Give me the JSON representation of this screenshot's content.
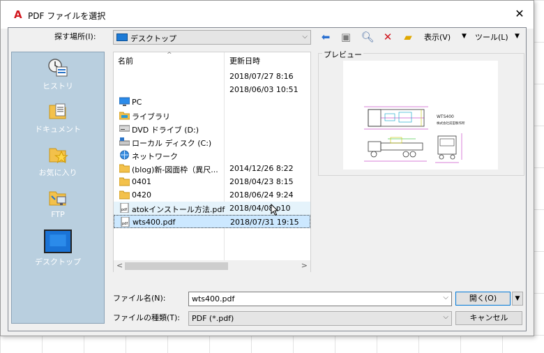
{
  "window": {
    "title": "PDF ファイルを選択",
    "app_icon": "autocad-a-icon"
  },
  "toolbar": {
    "look_in_label": "探す場所(I):",
    "look_in_value": "デスクトップ",
    "views_label": "表示(V)",
    "tools_label": "ツール(L)"
  },
  "places": [
    {
      "label": "ヒストリ",
      "icon": "history-icon"
    },
    {
      "label": "ドキュメント",
      "icon": "documents-icon"
    },
    {
      "label": "お気に入り",
      "icon": "favorites-icon"
    },
    {
      "label": "FTP",
      "icon": "ftp-icon"
    },
    {
      "label": "デスクトップ",
      "icon": "desktop-icon"
    }
  ],
  "file_list": {
    "columns": {
      "name": "名前",
      "modified": "更新日時"
    },
    "rows": [
      {
        "name": "",
        "date": "2018/07/27 8:16",
        "icon": ""
      },
      {
        "name": "",
        "date": "2018/06/03 10:51",
        "icon": ""
      },
      {
        "name": "PC",
        "date": "",
        "icon": "pc-icon"
      },
      {
        "name": "ライブラリ",
        "date": "",
        "icon": "library-icon"
      },
      {
        "name": "DVD ドライブ (D:)",
        "date": "",
        "icon": "dvd-icon"
      },
      {
        "name": "ローカル ディスク (C:)",
        "date": "",
        "icon": "disk-icon"
      },
      {
        "name": "ネットワーク",
        "date": "",
        "icon": "network-icon"
      },
      {
        "name": "(blog)新-図面枠（異尺...",
        "date": "2014/12/26 8:22",
        "icon": "folder-icon"
      },
      {
        "name": "0401",
        "date": "2018/04/23 8:15",
        "icon": "folder-icon"
      },
      {
        "name": "0420",
        "date": "2018/06/24 9:24",
        "icon": "folder-icon"
      },
      {
        "name": "atokインストール方法.pdf",
        "date": "2018/04/08 ᴅ10",
        "icon": "pdf-icon"
      },
      {
        "name": "wts400.pdf",
        "date": "2018/07/31 19:15",
        "icon": "pdf-icon"
      }
    ]
  },
  "preview": {
    "label": "プレビュー",
    "title_text": "WTS400",
    "subtitle_text": "株式会社前田製作所"
  },
  "form": {
    "file_name_label": "ファイル名(N):",
    "file_name_value": "wts400.pdf",
    "file_type_label": "ファイルの種類(T):",
    "file_type_value": "PDF (*.pdf)",
    "open_label": "開く(O)",
    "cancel_label": "キャンセル"
  },
  "colors": {
    "places_bg": "#b9cfdf",
    "selection": "#cce8ff",
    "desktop_blue": "#1c7ad6",
    "acad_red": "#d2171f"
  }
}
